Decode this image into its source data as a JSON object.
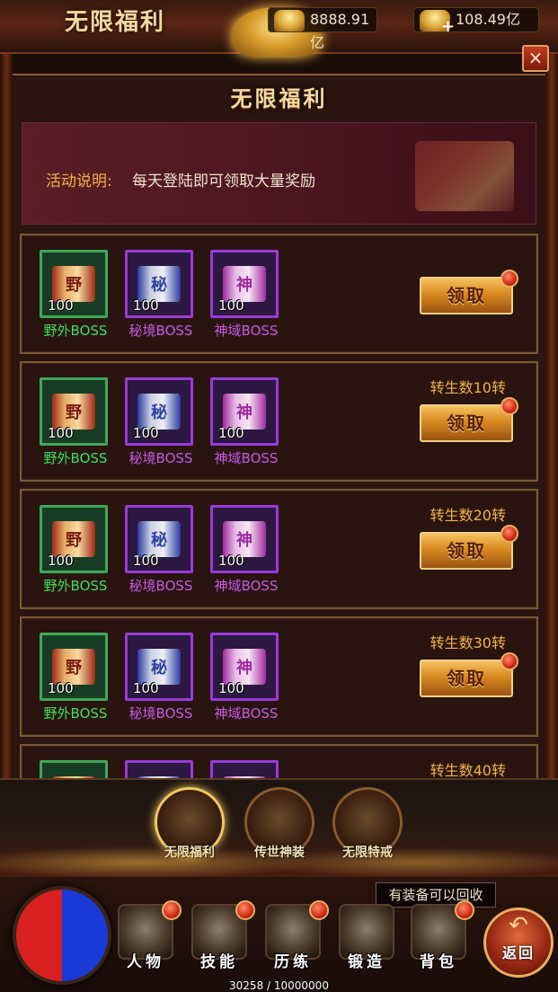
{
  "header": {
    "title": "无限福利",
    "gold": "8888.91亿",
    "yuanbao": "108.49亿",
    "plus": "+",
    "close": "×"
  },
  "panel": {
    "title": "无限福利",
    "notice_label": "活动说明:",
    "notice_text": "每天登陆即可领取大量奖励"
  },
  "rows": [
    {
      "requirement": "",
      "claim": "领取",
      "items": [
        {
          "glyph": "野",
          "qty": "100",
          "name": "野外BOSS"
        },
        {
          "glyph": "秘",
          "qty": "100",
          "name": "秘境BOSS"
        },
        {
          "glyph": "神",
          "qty": "100",
          "name": "神域BOSS"
        }
      ]
    },
    {
      "requirement": "转生数10转",
      "claim": "领取",
      "items": [
        {
          "glyph": "野",
          "qty": "100",
          "name": "野外BOSS"
        },
        {
          "glyph": "秘",
          "qty": "100",
          "name": "秘境BOSS"
        },
        {
          "glyph": "神",
          "qty": "100",
          "name": "神域BOSS"
        }
      ]
    },
    {
      "requirement": "转生数20转",
      "claim": "领取",
      "items": [
        {
          "glyph": "野",
          "qty": "100",
          "name": "野外BOSS"
        },
        {
          "glyph": "秘",
          "qty": "100",
          "name": "秘境BOSS"
        },
        {
          "glyph": "神",
          "qty": "100",
          "name": "神域BOSS"
        }
      ]
    },
    {
      "requirement": "转生数30转",
      "claim": "领取",
      "items": [
        {
          "glyph": "野",
          "qty": "100",
          "name": "野外BOSS"
        },
        {
          "glyph": "秘",
          "qty": "100",
          "name": "秘境BOSS"
        },
        {
          "glyph": "神",
          "qty": "100",
          "name": "神域BOSS"
        }
      ]
    },
    {
      "requirement": "转生数40转",
      "claim": "",
      "items": [
        {
          "glyph": "野",
          "qty": "",
          "name": ""
        },
        {
          "glyph": "秘",
          "qty": "",
          "name": ""
        },
        {
          "glyph": "神",
          "qty": "",
          "name": ""
        }
      ]
    }
  ],
  "tabs": [
    {
      "label": "无限福利",
      "active": true
    },
    {
      "label": "传世神装",
      "active": false
    },
    {
      "label": "无限特戒",
      "active": false
    }
  ],
  "bottom": {
    "tooltip": "有装备可以回收",
    "nav": [
      "人物",
      "技能",
      "历练",
      "锻造",
      "背包"
    ],
    "back": "返回",
    "back_arrow": "↶",
    "exp": "30258 / 10000000"
  }
}
